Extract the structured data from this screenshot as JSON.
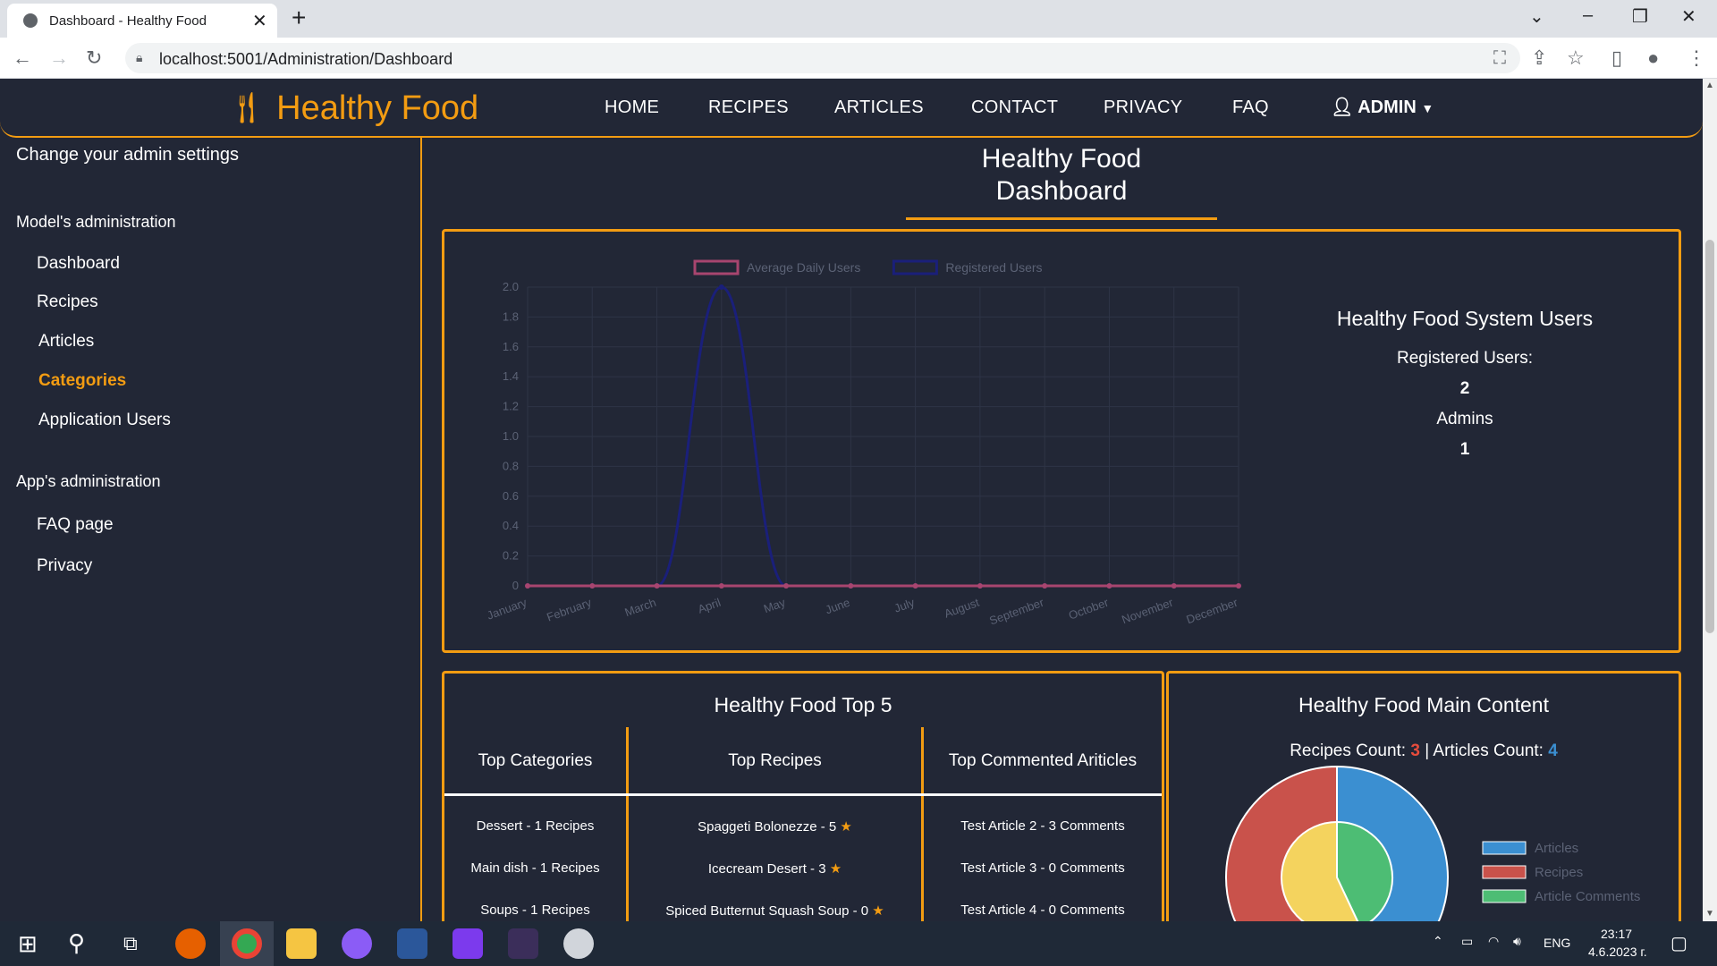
{
  "browser": {
    "tab_title": "Dashboard - Healthy Food",
    "url": "localhost:5001/Administration/Dashboard"
  },
  "navbar": {
    "brand": "Healthy Food",
    "links": [
      "HOME",
      "RECIPES",
      "ARTICLES",
      "CONTACT",
      "PRIVACY",
      "FAQ"
    ],
    "user": "ADMIN"
  },
  "sidebar": {
    "intro": "Change your admin settings",
    "model_heading": "Model's administration",
    "model_items": [
      "Dashboard",
      "Recipes",
      "Articles",
      "Categories",
      "Application Users"
    ],
    "active_item": "Categories",
    "app_heading": "App's administration",
    "app_items": [
      "FAQ page",
      "Privacy"
    ]
  },
  "main": {
    "title_line1": "Healthy Food",
    "title_line2": "Dashboard"
  },
  "chart_data": [
    {
      "type": "line",
      "title": "",
      "x": [
        "January",
        "February",
        "March",
        "April",
        "May",
        "June",
        "July",
        "August",
        "September",
        "October",
        "November",
        "December"
      ],
      "series": [
        {
          "name": "Average Daily Users",
          "values": [
            0,
            0,
            0,
            0,
            0,
            0,
            0,
            0,
            0,
            0,
            0,
            0
          ],
          "color": "#a8456f"
        },
        {
          "name": "Registered Users",
          "values": [
            0,
            0,
            0,
            2,
            0,
            0,
            0,
            0,
            0,
            0,
            0,
            0
          ],
          "color": "#1a1f7a"
        }
      ],
      "ylim": [
        0,
        2
      ],
      "yticks": [
        "2.0",
        "1.8",
        "1.6",
        "1.4",
        "1.2",
        "1.0",
        "0.8",
        "0.6",
        "0.4",
        "0.2",
        "0"
      ],
      "legend": "top",
      "grid": true
    },
    {
      "type": "pie",
      "title": "",
      "categories": [
        "Articles",
        "Recipes",
        "Article Comments"
      ],
      "colors": [
        "#3b8fd1",
        "#c9524b",
        "#4dbd74"
      ],
      "inner_category_colors": [
        "#f4d35e"
      ],
      "legend": "right"
    }
  ],
  "users_box": {
    "title": "Healthy Food System Users",
    "registered_label": "Registered Users:",
    "registered_value": "2",
    "admins_label": "Admins",
    "admins_value": "1"
  },
  "top5": {
    "title": "Healthy Food Top 5",
    "col_categories": "Top Categories",
    "col_recipes": "Top Recipes",
    "col_articles": "Top Commented Ariticles",
    "categories": [
      "Dessert - 1 Recipes",
      "Main dish - 1 Recipes",
      "Soups - 1 Recipes"
    ],
    "recipes": [
      "Spaggeti Bolonezze - 5",
      "Icecream Desert - 3",
      "Spiced Butternut Squash Soup - 0"
    ],
    "articles": [
      "Test Article 2 - 3 Comments",
      "Test Article 3 - 0 Comments",
      "Test Article 4 - 0 Comments"
    ]
  },
  "main_content": {
    "title": "Healthy Food Main Content",
    "recipes_label": "Recipes Count: ",
    "recipes_count": "3",
    "separator": " | ",
    "articles_label": "Articles Count: ",
    "articles_count": "4"
  },
  "taskbar": {
    "lang": "ENG",
    "time": "23:17",
    "date": "4.6.2023 г."
  }
}
